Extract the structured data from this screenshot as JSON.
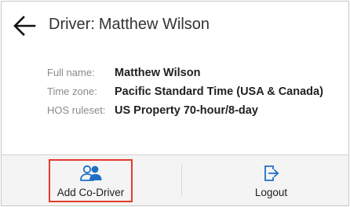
{
  "header": {
    "prefix": "Driver:",
    "driver_name": "Matthew Wilson",
    "back_icon": "arrow-left-icon"
  },
  "details": [
    {
      "label": "Full name:",
      "value": "Matthew Wilson"
    },
    {
      "label": "Time zone:",
      "value": "Pacific Standard Time (USA & Canada)"
    },
    {
      "label": "HOS ruleset:",
      "value": "US Property 70-hour/8-day"
    }
  ],
  "actions": {
    "add_codriver": {
      "label": "Add Co-Driver",
      "icon": "add-users-icon"
    },
    "logout": {
      "label": "Logout",
      "icon": "logout-icon"
    }
  },
  "colors": {
    "accent": "#1f6fc5",
    "highlight": "#e53b2b"
  }
}
